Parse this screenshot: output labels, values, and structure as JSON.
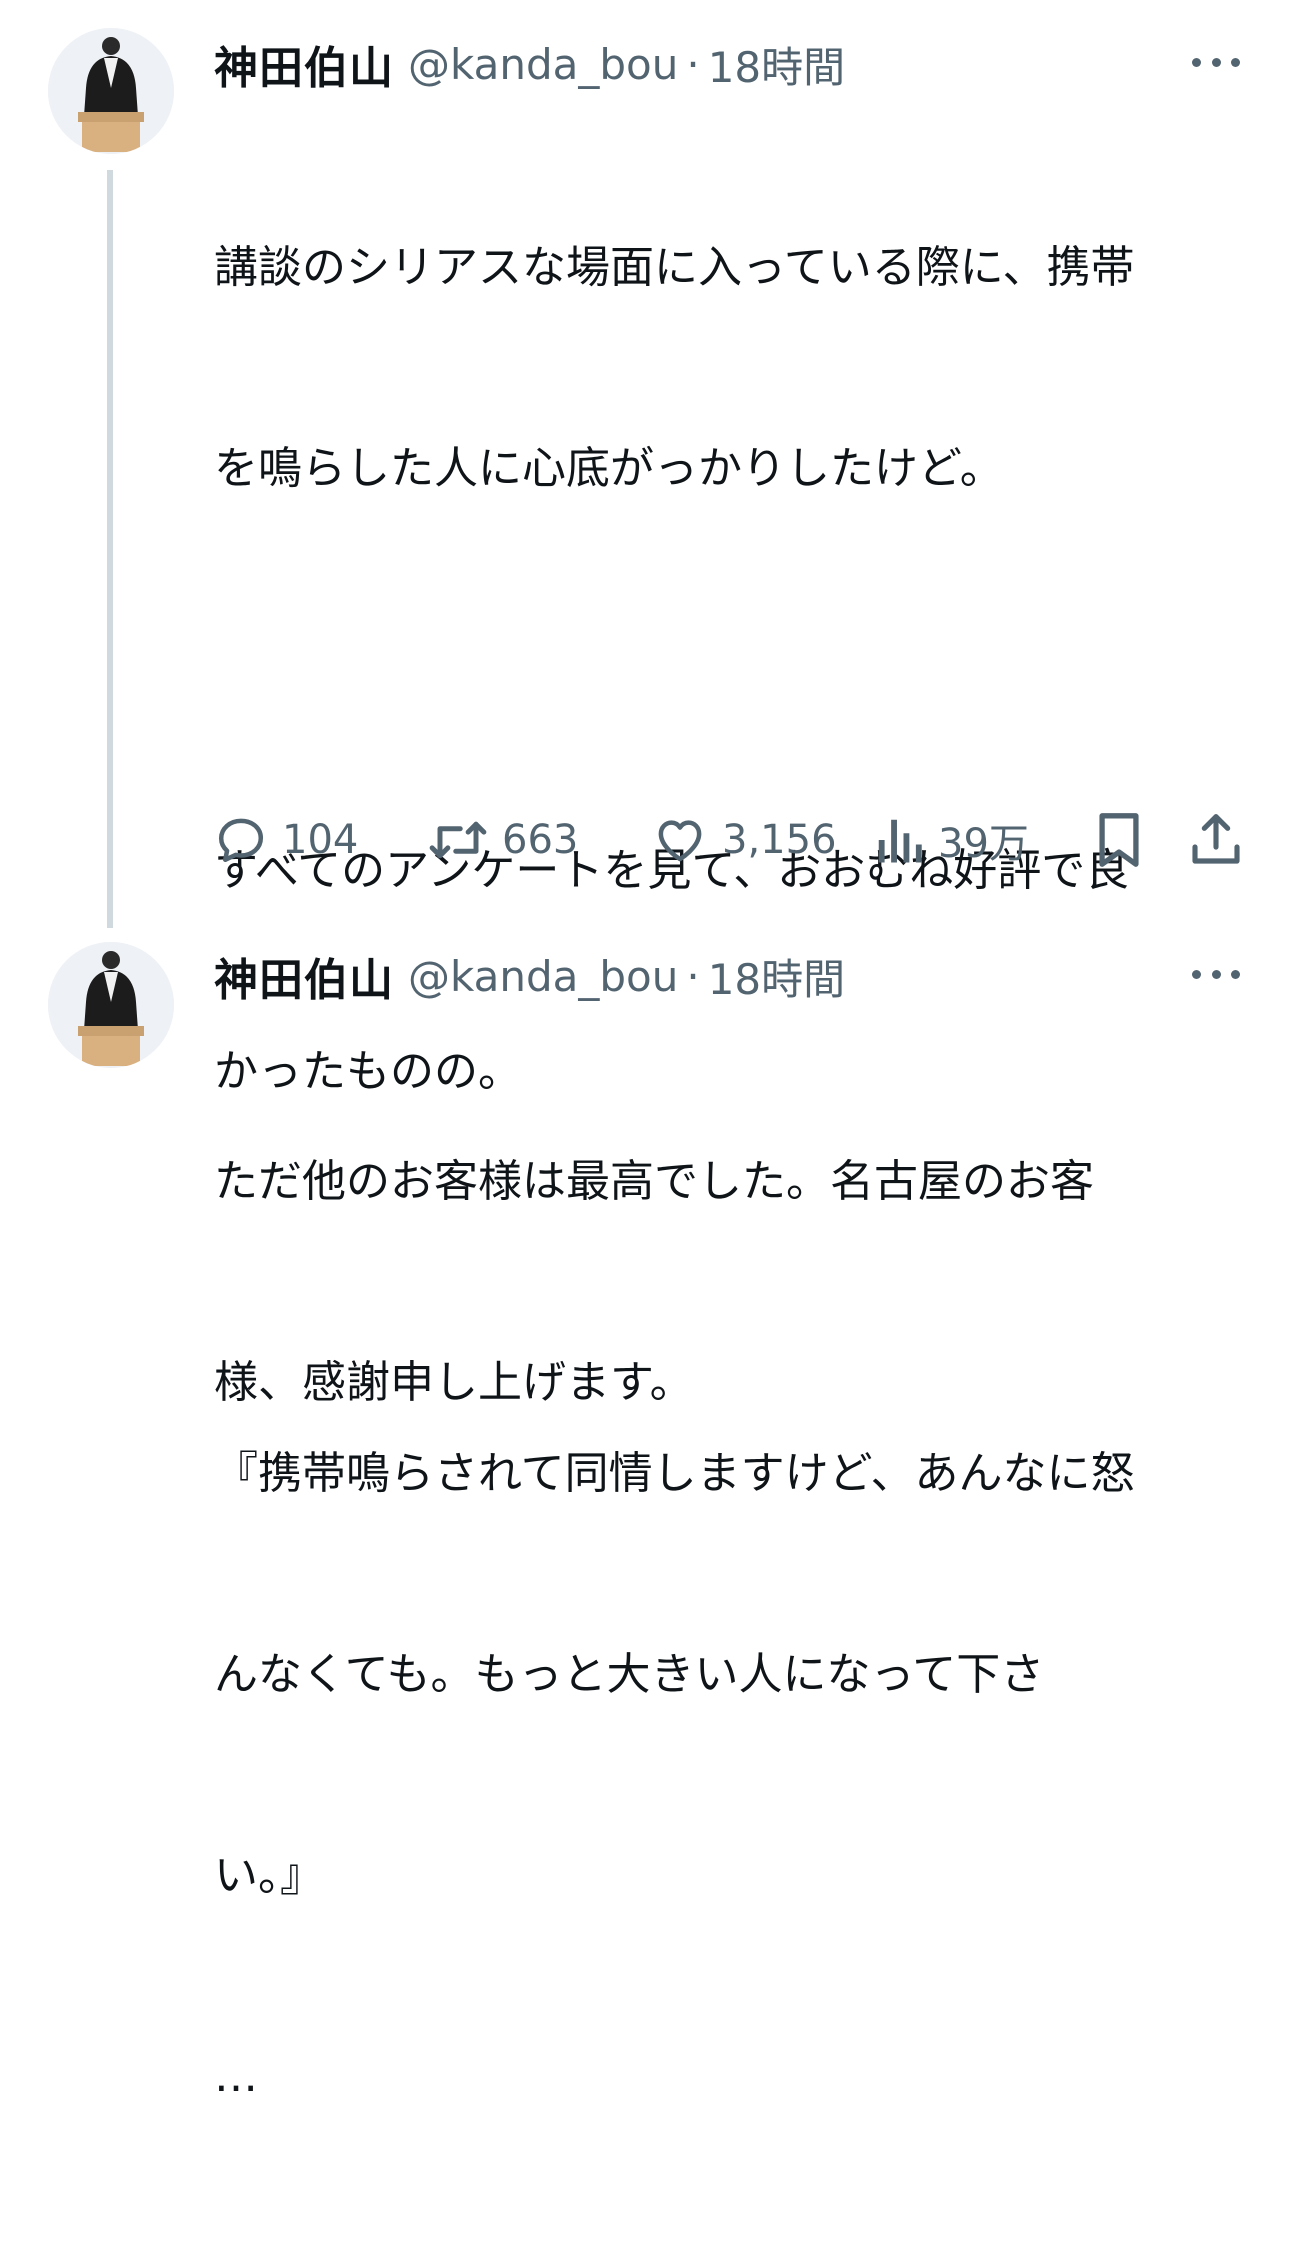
{
  "tweets": [
    {
      "author_name": "神田伯山",
      "handle": "@kanda_bou",
      "separator": "·",
      "time": "18時間",
      "lines": [
        "講談のシリアスな場面に入っている際に、携帯",
        "を鳴らした人に心底がっかりしたけど。",
        "",
        "すべてのアンケートを見て、おおむね好評で良",
        "かったものの。",
        "",
        "『携帯鳴らされて同情しますけど、あんなに怒",
        "んなくても。もっと大きい人になって下さ",
        "い。』",
        "…"
      ],
      "actions": {
        "reply_count": "104",
        "retweet_count": "663",
        "like_count": "3,156",
        "views_count": "39万"
      }
    },
    {
      "author_name": "神田伯山",
      "handle": "@kanda_bou",
      "separator": "·",
      "time": "18時間",
      "lines": [
        "ただ他のお客様は最高でした。名古屋のお客",
        "様、感謝申し上げます。"
      ]
    }
  ],
  "icons": {
    "reply": "speech-bubble-icon",
    "retweet": "retweet-arrows-icon",
    "like": "heart-icon",
    "views": "bar-chart-icon",
    "bookmark": "bookmark-icon",
    "share": "share-upload-icon",
    "more": "more-dots-icon"
  },
  "colors": {
    "text": "#0f1419",
    "secondary": "#536471",
    "thread_line": "#cfd9de"
  }
}
